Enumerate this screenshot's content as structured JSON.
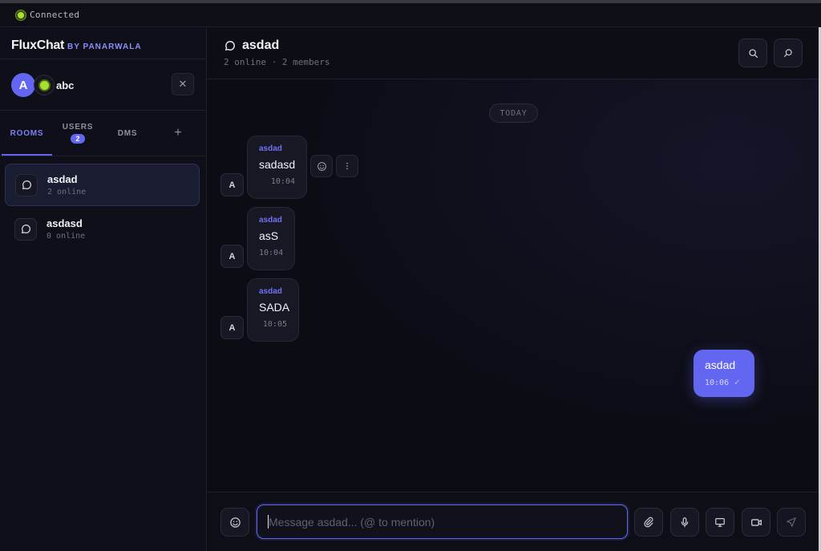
{
  "status": {
    "text": "Connected",
    "color": "#a6e22e"
  },
  "brand": {
    "name": "FluxChat",
    "by": "BY PANARWALA"
  },
  "user": {
    "initial": "A",
    "name": "abc",
    "close_icon": "close-icon"
  },
  "tabs": {
    "rooms": "ROOMS",
    "users": "USERS",
    "users_badge": "2",
    "dms": "DMS",
    "add": "+"
  },
  "rooms": [
    {
      "name": "asdad",
      "sub": "2 online"
    },
    {
      "name": "asdasd",
      "sub": "0 online"
    }
  ],
  "header": {
    "title": "asdad",
    "sub": "2 online · 2 members"
  },
  "day_divider": "TODAY",
  "messages": [
    {
      "avatar": "A",
      "author": "asdad",
      "text": "sadasd",
      "time": "10:04"
    },
    {
      "avatar": "A",
      "author": "asdad",
      "text": "asS",
      "time": "10:04"
    },
    {
      "avatar": "A",
      "author": "asdad",
      "text": "SADA",
      "time": "10:05"
    }
  ],
  "own_message": {
    "text": "asdad",
    "time": "10:06",
    "check": "✓"
  },
  "composer": {
    "placeholder": "Message asdad... (@ to mention)"
  },
  "colors": {
    "accent": "#6366f1",
    "online": "#a6e22e"
  }
}
